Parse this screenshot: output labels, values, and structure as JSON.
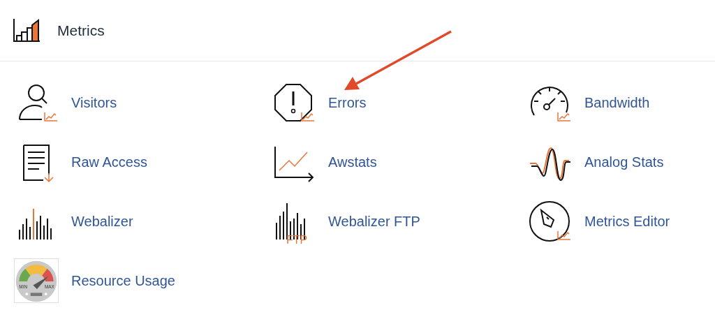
{
  "header": {
    "title": "Metrics"
  },
  "items": [
    {
      "label": "Visitors",
      "kind": "visitors"
    },
    {
      "label": "Errors",
      "kind": "errors"
    },
    {
      "label": "Bandwidth",
      "kind": "bandwidth"
    },
    {
      "label": "Raw Access",
      "kind": "rawaccess"
    },
    {
      "label": "Awstats",
      "kind": "awstats"
    },
    {
      "label": "Analog Stats",
      "kind": "analog"
    },
    {
      "label": "Webalizer",
      "kind": "webalizer"
    },
    {
      "label": "Webalizer FTP",
      "kind": "webalizerftp",
      "icon_text": "FTP"
    },
    {
      "label": "Metrics Editor",
      "kind": "editor"
    },
    {
      "label": "Resource Usage",
      "kind": "resource",
      "icon_texts": [
        "MIN",
        "MAX"
      ]
    }
  ]
}
